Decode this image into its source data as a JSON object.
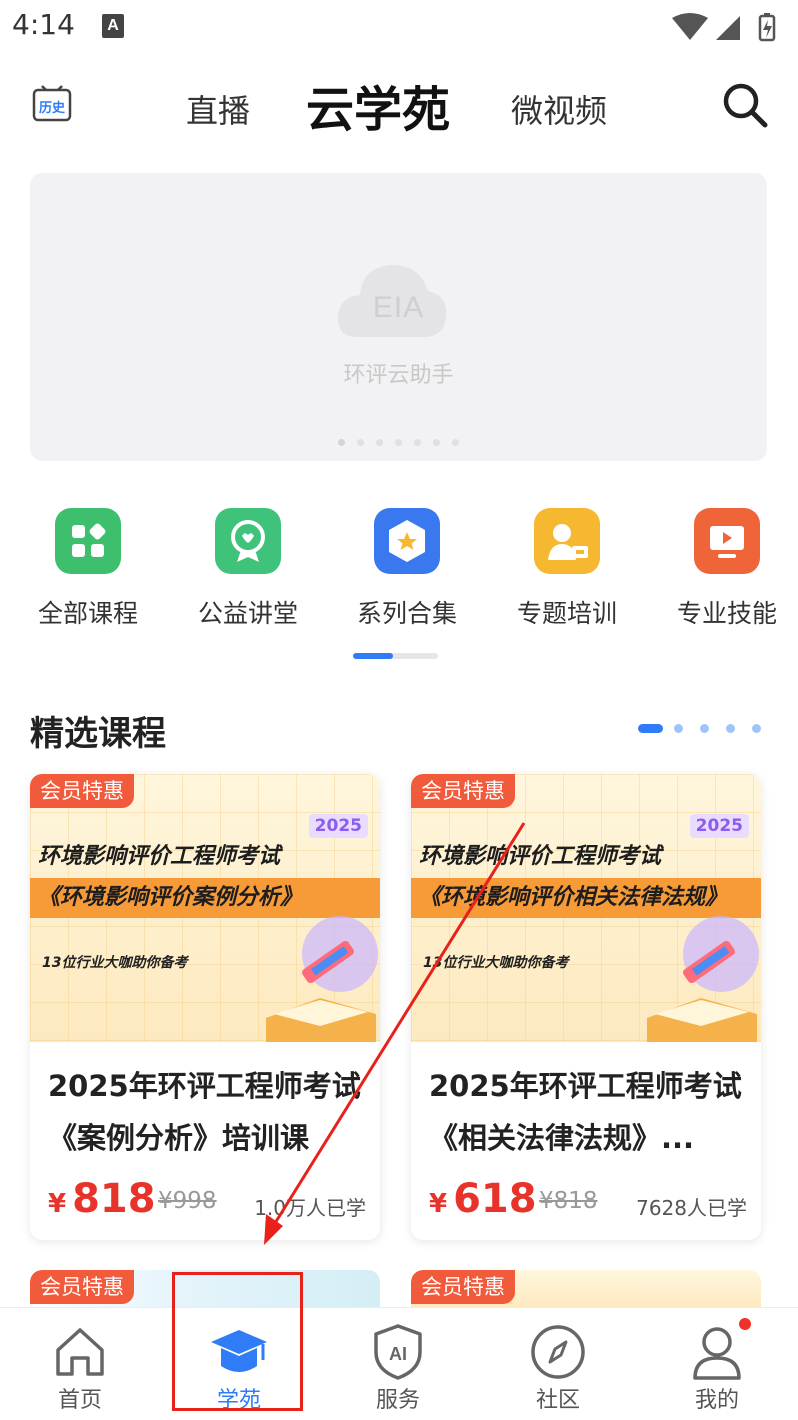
{
  "status_bar": {
    "time": "4:14",
    "notification_icon": "A"
  },
  "header": {
    "history_label": "历史",
    "tab_live": "直播",
    "title": "云学苑",
    "tab_video": "微视频"
  },
  "banner": {
    "logo_text": "EIA",
    "caption": "环评云助手",
    "dots": 7,
    "active_dot": 0
  },
  "categories": [
    {
      "label": "全部课程",
      "icon": "grid-icon",
      "color": "#3dbf6e"
    },
    {
      "label": "公益讲堂",
      "icon": "badge-icon",
      "color": "#3fc37b"
    },
    {
      "label": "系列合集",
      "icon": "star-hexagon-icon",
      "color": "#3a78f0"
    },
    {
      "label": "专题培训",
      "icon": "teacher-icon",
      "color": "#f5b830"
    },
    {
      "label": "专业技能",
      "icon": "play-screen-icon",
      "color": "#f0643a"
    }
  ],
  "category_scroll": {
    "fraction": 0.47
  },
  "section": {
    "title": "精选课程",
    "page_dots": 5,
    "active_page": 0
  },
  "courses": [
    {
      "badge": "会员特惠",
      "cover_year": "2025",
      "cover_line1": "环境影响评价工程师考试",
      "cover_line2": "《环境影响评价案例分析》",
      "cover_line3": "13位行业大咖助你备考",
      "title": "2025年环评工程师考试《案例分析》培训课",
      "currency": "¥",
      "price": "818",
      "old_price": "¥998",
      "learners": "1.0万人已学"
    },
    {
      "badge": "会员特惠",
      "cover_year": "2025",
      "cover_line1": "环境影响评价工程师考试",
      "cover_line2": "《环境影响评价相关法律法规》",
      "cover_line3": "13位行业大咖助你备考",
      "title": "2025年环评工程师考试《相关法律法规》...",
      "currency": "¥",
      "price": "618",
      "old_price": "¥818",
      "learners": "7628人已学"
    }
  ],
  "next_courses": [
    {
      "badge": "会员特惠"
    },
    {
      "badge": "会员特惠"
    }
  ],
  "bottom_nav": [
    {
      "label": "首页",
      "icon": "home-icon",
      "active": false
    },
    {
      "label": "学苑",
      "icon": "graduation-cap-icon",
      "active": true
    },
    {
      "label": "服务",
      "icon": "ai-shield-icon",
      "active": false
    },
    {
      "label": "社区",
      "icon": "compass-icon",
      "active": false
    },
    {
      "label": "我的",
      "icon": "user-icon",
      "active": false,
      "has_dot": true
    }
  ],
  "colors": {
    "accent": "#2f7cf6",
    "price": "#e8332a",
    "badge": "#f25a3c",
    "annotation": "#e8221a"
  }
}
